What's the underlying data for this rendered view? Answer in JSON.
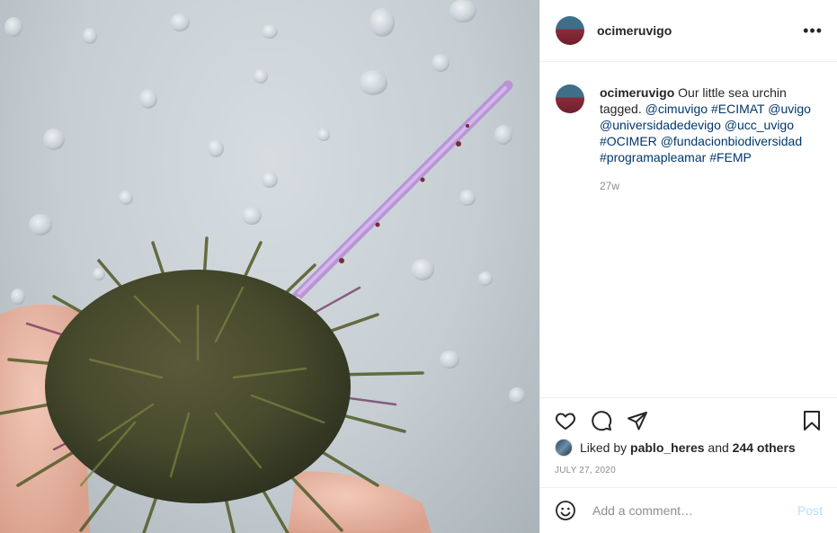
{
  "post": {
    "author": "ocimeruvigo",
    "caption": {
      "text_lead": "Our little sea urchin tagged.",
      "tags": [
        "@cimuvigo",
        "#ECIMAT",
        "@uvigo",
        "@universidadedevigo",
        "@ucc_uvigo",
        "#OCIMER",
        "@fundacionbiodiversidad",
        "#programapleamar",
        "#FEMP"
      ],
      "age": "27w"
    },
    "likes": {
      "prefix": "Liked by",
      "user": "pablo_heres",
      "connector": "and",
      "others": "244 others"
    },
    "date": "JULY 27, 2020"
  },
  "icons": {
    "more": "more-options-icon",
    "like": "heart-icon",
    "comment": "comment-bubble-icon",
    "share": "paper-plane-icon",
    "save": "bookmark-icon",
    "emoji": "smiley-icon"
  },
  "comment_box": {
    "placeholder": "Add a comment…",
    "post_label": "Post"
  },
  "colors": {
    "link": "#00376b",
    "muted": "#8e8e8e",
    "post_button_disabled": "#b2dffc",
    "text": "#262626"
  }
}
